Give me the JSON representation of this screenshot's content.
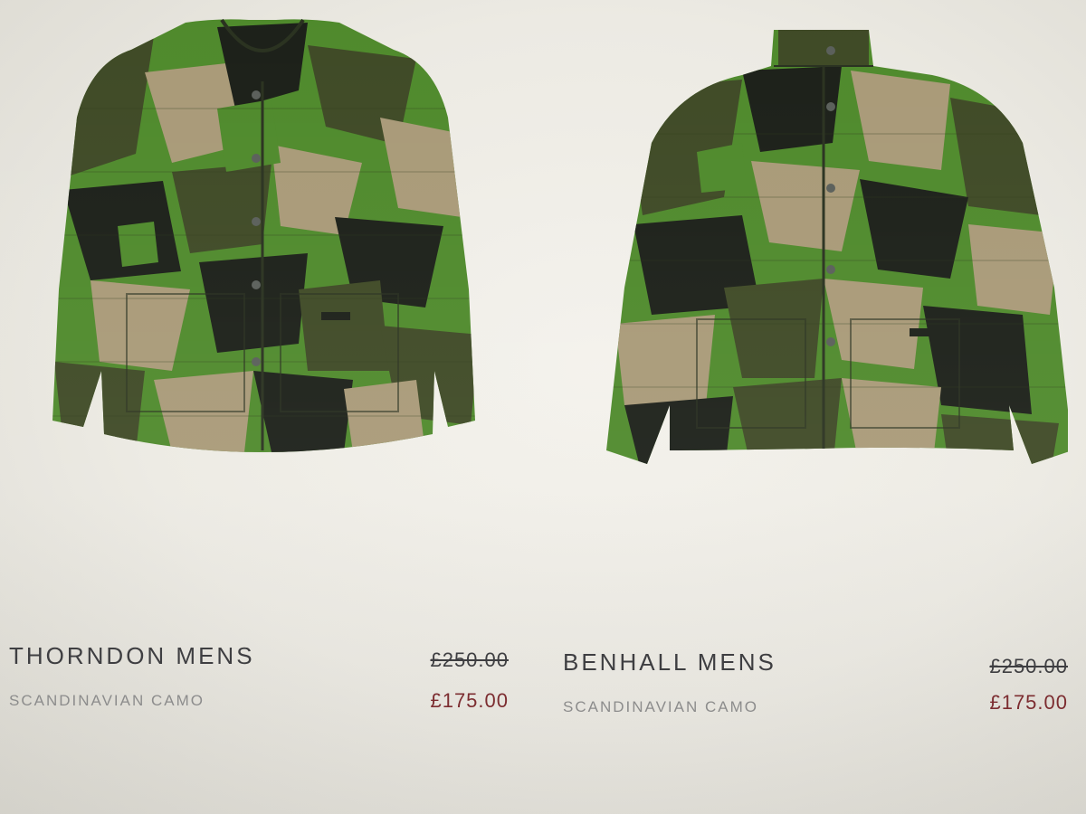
{
  "products": [
    {
      "name": "THORNDON MENS",
      "colorway": "SCANDINAVIAN CAMO",
      "original_price": "£250.00",
      "sale_price": "£175.00",
      "image_icon": "collarless-camo-jacket-image"
    },
    {
      "name": "BENHALL MENS",
      "colorway": "SCANDINAVIAN CAMO",
      "original_price": "£250.00",
      "sale_price": "£175.00",
      "image_icon": "stand-collar-camo-jacket-image"
    }
  ],
  "colors": {
    "sale_price": "#7d2a2e",
    "name_text": "#3b3b3e",
    "subtitle_text": "#8e8e8e",
    "camo_green": "#4f8a2c",
    "camo_tan": "#a99a78",
    "camo_olive": "#3f4a26",
    "camo_black": "#1c2019"
  }
}
